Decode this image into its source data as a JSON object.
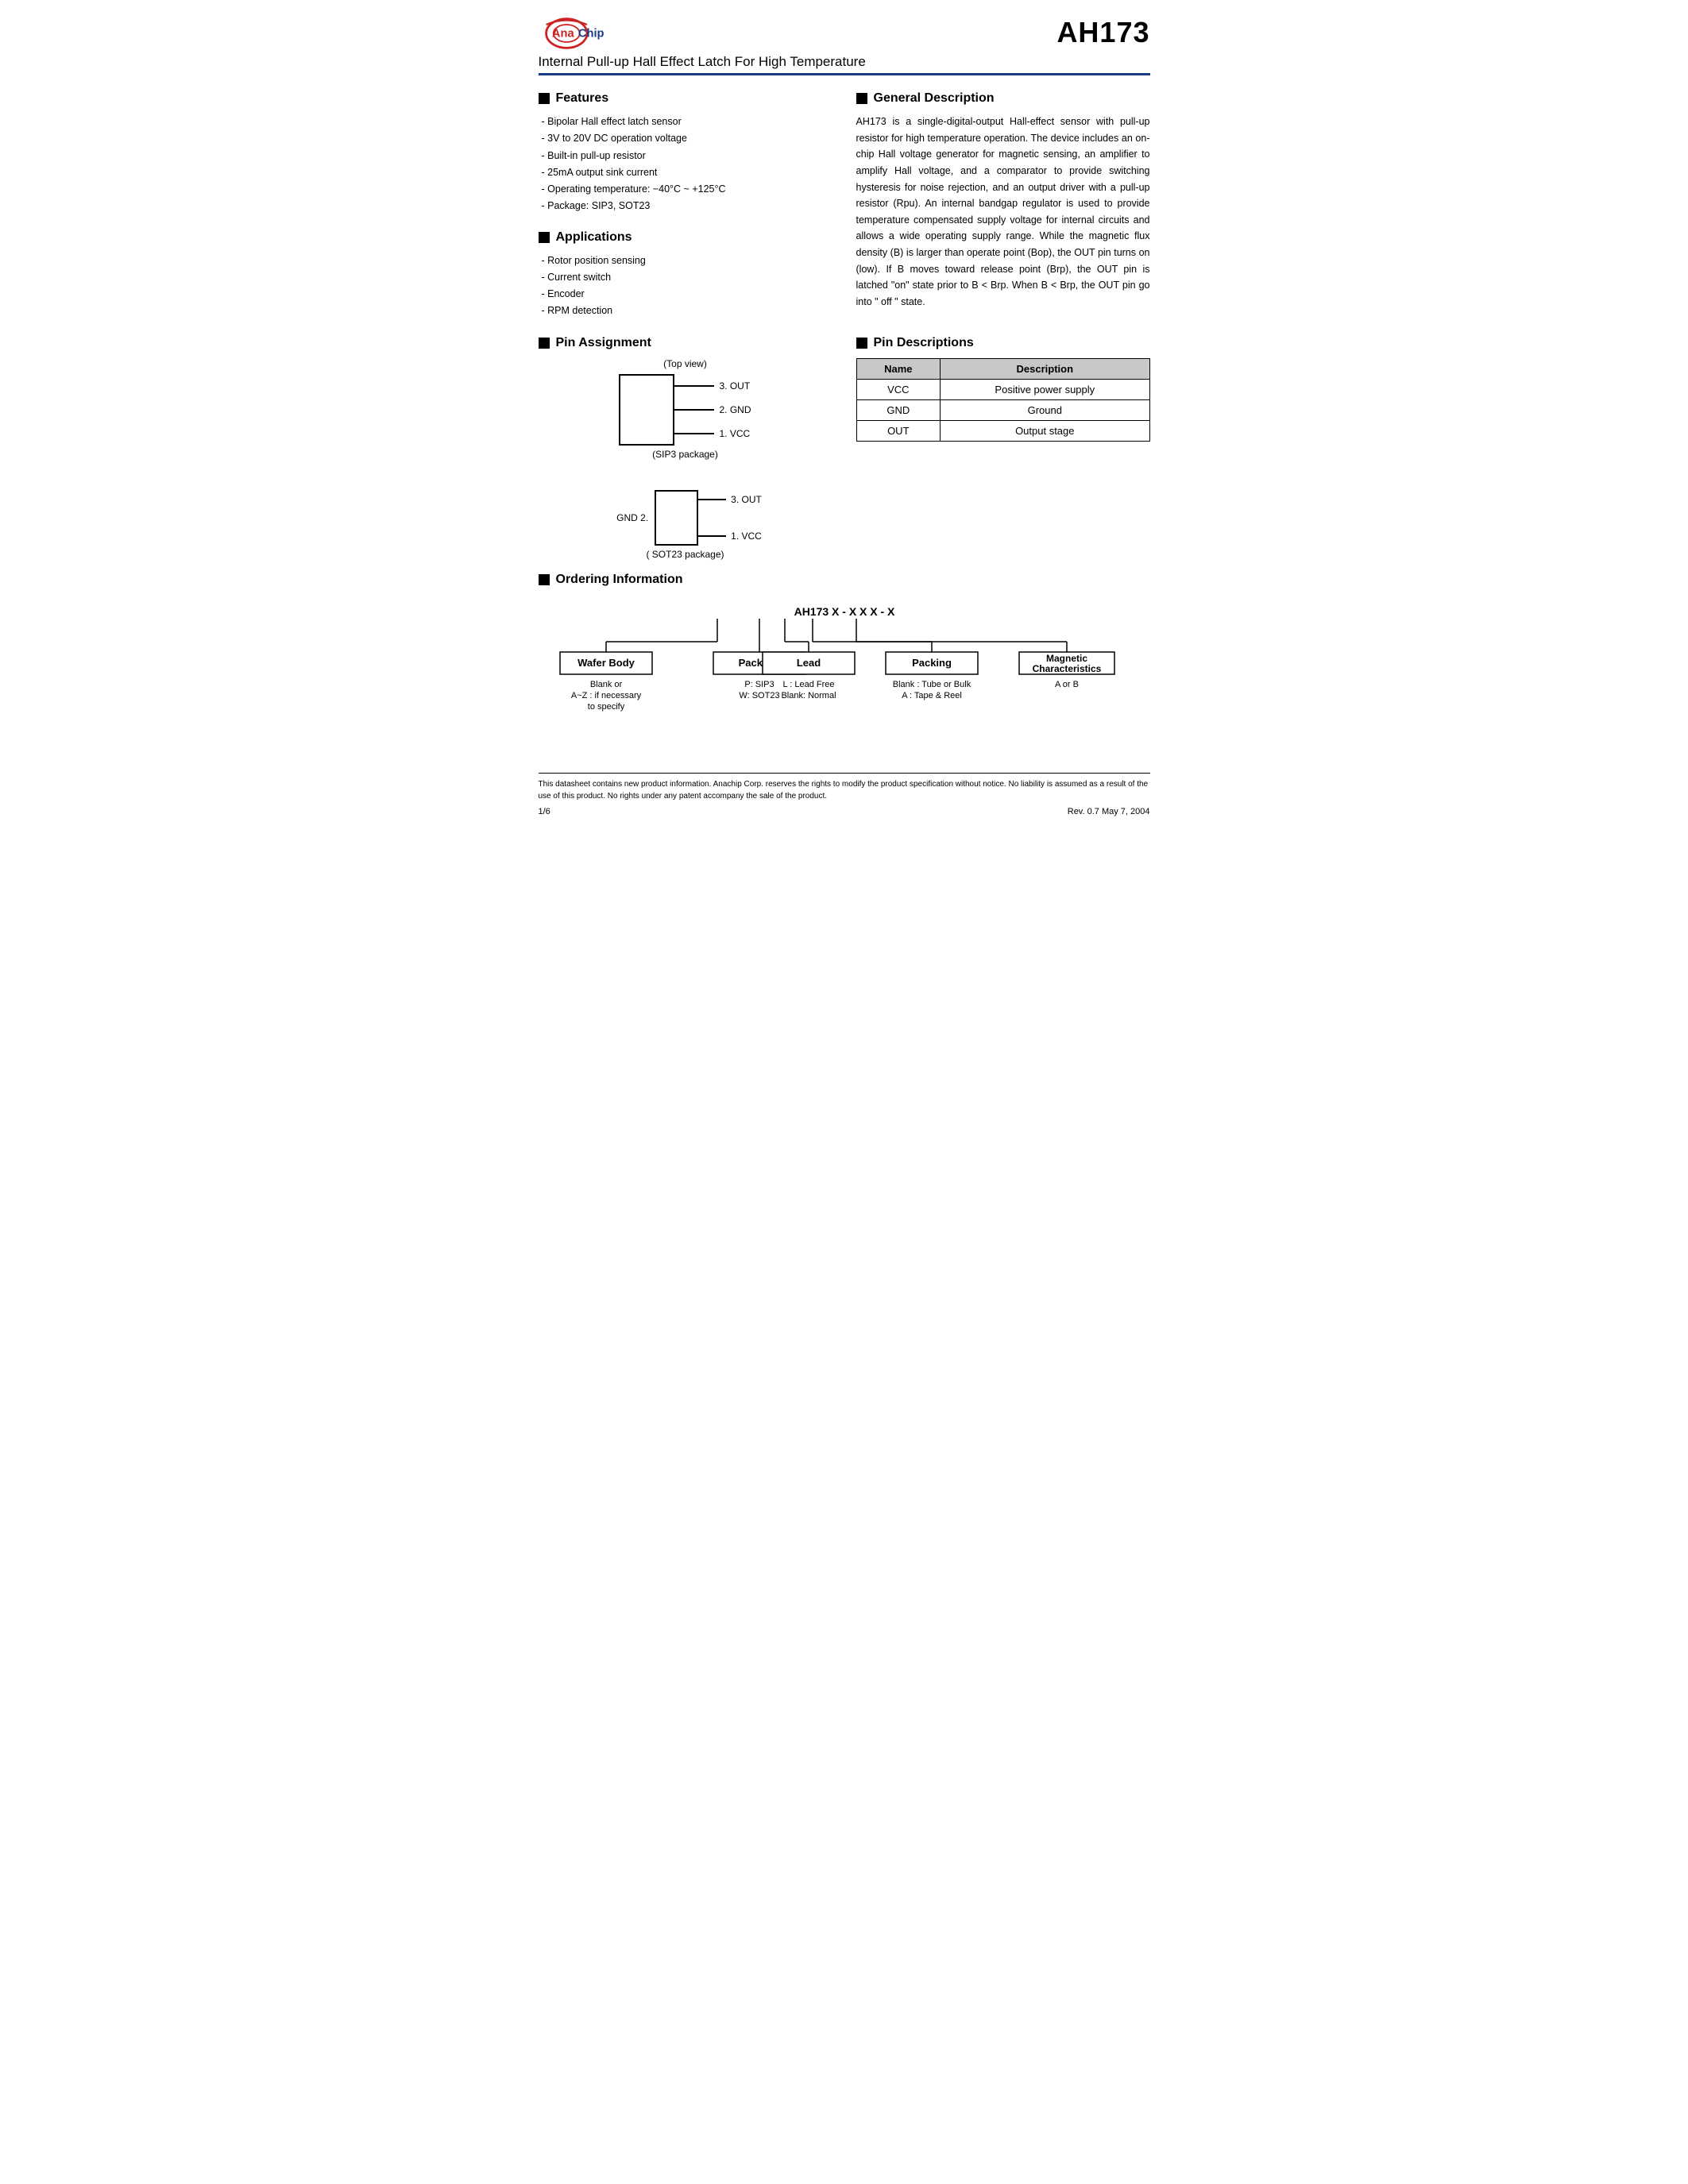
{
  "header": {
    "logo_text": "AnaChip",
    "product_title": "AH173",
    "subtitle": "Internal Pull-up Hall Effect Latch For High Temperature"
  },
  "features": {
    "section_title": "Features",
    "items": [
      "Bipolar Hall effect latch sensor",
      "3V to 20V DC operation voltage",
      "Built-in pull-up resistor",
      "25mA output sink current",
      "Operating temperature:  −40°C ~ +125°C",
      "Package: SIP3, SOT23"
    ]
  },
  "applications": {
    "section_title": "Applications",
    "items": [
      "Rotor position sensing",
      "Current switch",
      "Encoder",
      "RPM detection"
    ]
  },
  "general_description": {
    "section_title": "General Description",
    "text": "AH173 is a single-digital-output Hall-effect sensor with pull-up resistor for high temperature operation. The device includes an on-chip Hall voltage generator for magnetic sensing, an amplifier to amplify Hall voltage, and a comparator to provide switching hysteresis for noise rejection, and an output driver with a pull-up resistor (Rpu). An internal bandgap regulator is used to provide temperature compensated supply voltage for internal circuits and allows a wide operating supply range. While the magnetic flux density (B) is larger than operate point (Bop), the OUT pin turns on (low). If B moves toward release point (Brp), the OUT pin is latched \"on\" state prior to B < Brp. When B < Brp, the OUT pin go into \" off \" state."
  },
  "pin_assignment": {
    "section_title": "Pin Assignment",
    "top_view_label": "(Top view)",
    "sip3_pins": [
      {
        "number": "3",
        "name": "OUT"
      },
      {
        "number": "2",
        "name": "GND"
      },
      {
        "number": "1",
        "name": "VCC"
      }
    ],
    "sip3_package_label": "(SIP3 package)",
    "sot23_pins_right": [
      {
        "number": "3",
        "name": "OUT"
      },
      {
        "number": "1",
        "name": "VCC"
      }
    ],
    "sot23_left_label": "GND  2.",
    "sot23_package_label": "( SOT23 package)"
  },
  "pin_descriptions": {
    "section_title": "Pin Descriptions",
    "table_headers": [
      "Name",
      "Description"
    ],
    "rows": [
      {
        "name": "VCC",
        "description": "Positive power supply"
      },
      {
        "name": "GND",
        "description": "Ground"
      },
      {
        "name": "OUT",
        "description": "Output stage"
      }
    ]
  },
  "ordering_information": {
    "section_title": "Ordering Information",
    "part_number": "AH173 X - X X X - X",
    "boxes": [
      {
        "label": "Wafer Body",
        "desc": "Blank or\nA~Z : if necessary\nto specify"
      },
      {
        "label": "Package",
        "desc": "P: SIP3\nW: SOT23"
      },
      {
        "label": "Lead",
        "desc": "L : Lead Free\nBlank: Normal"
      },
      {
        "label": "Packing",
        "desc": "Blank : Tube or Bulk\nA    : Tape & Reel"
      },
      {
        "label": "Magnetic\nCharacteristics",
        "desc": "A or B"
      }
    ]
  },
  "footer": {
    "disclaimer": "This datasheet contains new product information. Anachip Corp. reserves the rights to modify the product specification without notice. No liability is assumed as a result of the use of this product. No rights under any patent accompany the sale of the product.",
    "page": "1/6",
    "revision": "Rev. 0.7  May 7, 2004"
  }
}
